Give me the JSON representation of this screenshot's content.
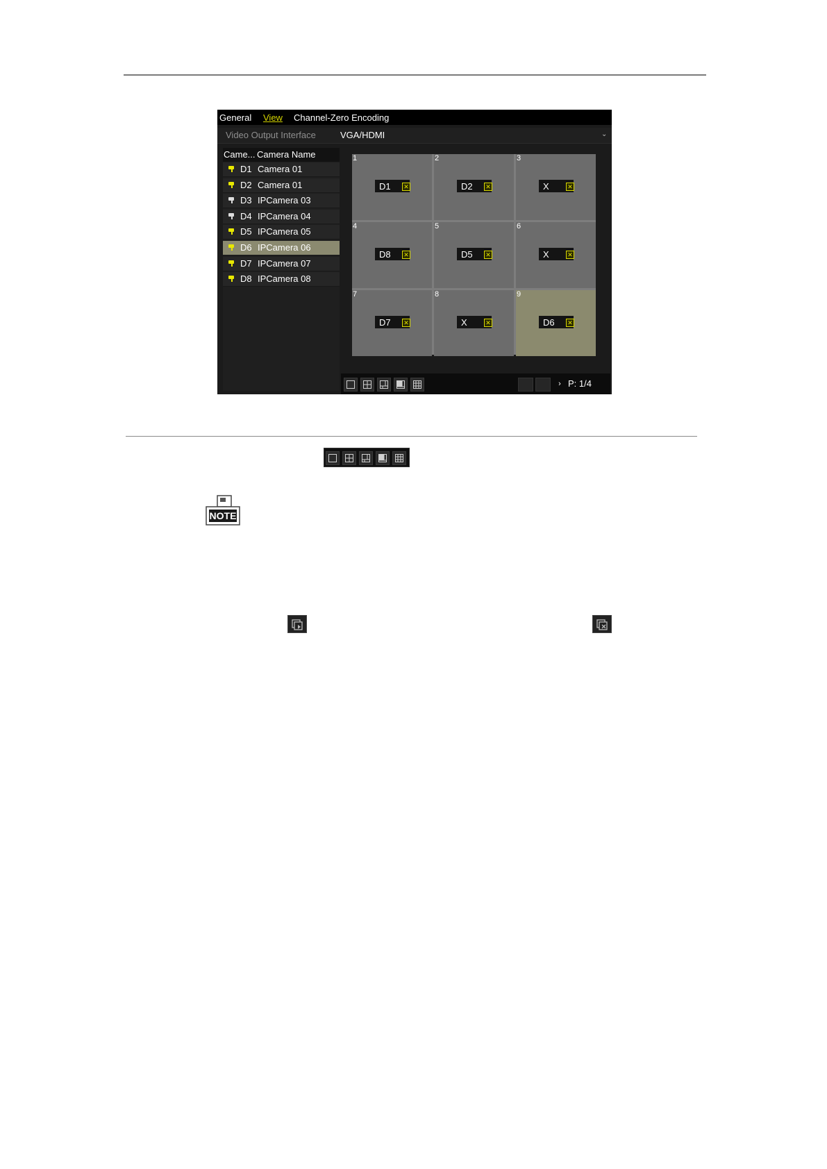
{
  "tabs": [
    "General",
    "View",
    "Channel-Zero Encoding"
  ],
  "active_tab": "View",
  "video_output": {
    "label": "Video Output Interface",
    "value": "VGA/HDMI"
  },
  "camera_list": {
    "header_no": "Came...",
    "header_name": "Camera Name",
    "rows": [
      {
        "id": "D1",
        "name": "Camera 01",
        "icon_color": "#e8e800",
        "selected": false
      },
      {
        "id": "D2",
        "name": "Camera 01",
        "icon_color": "#e8e800",
        "selected": false
      },
      {
        "id": "D3",
        "name": "IPCamera 03",
        "icon_color": "#dddddd",
        "selected": false
      },
      {
        "id": "D4",
        "name": "IPCamera 04",
        "icon_color": "#dddddd",
        "selected": false
      },
      {
        "id": "D5",
        "name": "IPCamera 05",
        "icon_color": "#e8e800",
        "selected": false
      },
      {
        "id": "D6",
        "name": "IPCamera 06",
        "icon_color": "#e8e800",
        "selected": true
      },
      {
        "id": "D7",
        "name": "IPCamera 07",
        "icon_color": "#e8e800",
        "selected": false
      },
      {
        "id": "D8",
        "name": "IPCamera 08",
        "icon_color": "#e8e800",
        "selected": false
      }
    ]
  },
  "grid": {
    "cells": [
      {
        "num": "1",
        "label": "D1",
        "selected": false
      },
      {
        "num": "2",
        "label": "D2",
        "selected": false
      },
      {
        "num": "3",
        "label": "X",
        "selected": false
      },
      {
        "num": "4",
        "label": "D8",
        "selected": false
      },
      {
        "num": "5",
        "label": "D5",
        "selected": false
      },
      {
        "num": "6",
        "label": "X",
        "selected": false
      },
      {
        "num": "7",
        "label": "D7",
        "selected": false
      },
      {
        "num": "8",
        "label": "X",
        "selected": false
      },
      {
        "num": "9",
        "label": "D6",
        "selected": true
      }
    ],
    "remove_glyph": "✕"
  },
  "bottom_bar": {
    "layouts": [
      "layout-1-icon",
      "layout-4-icon",
      "layout-6-icon",
      "layout-8-icon",
      "layout-9-icon"
    ],
    "next_glyph": "›",
    "page": "P: 1/4"
  },
  "inline_icons": {
    "note_text": "NOTE",
    "start_live_icon": "start-live-view-icon",
    "stop_live_icon": "stop-live-view-icon"
  }
}
